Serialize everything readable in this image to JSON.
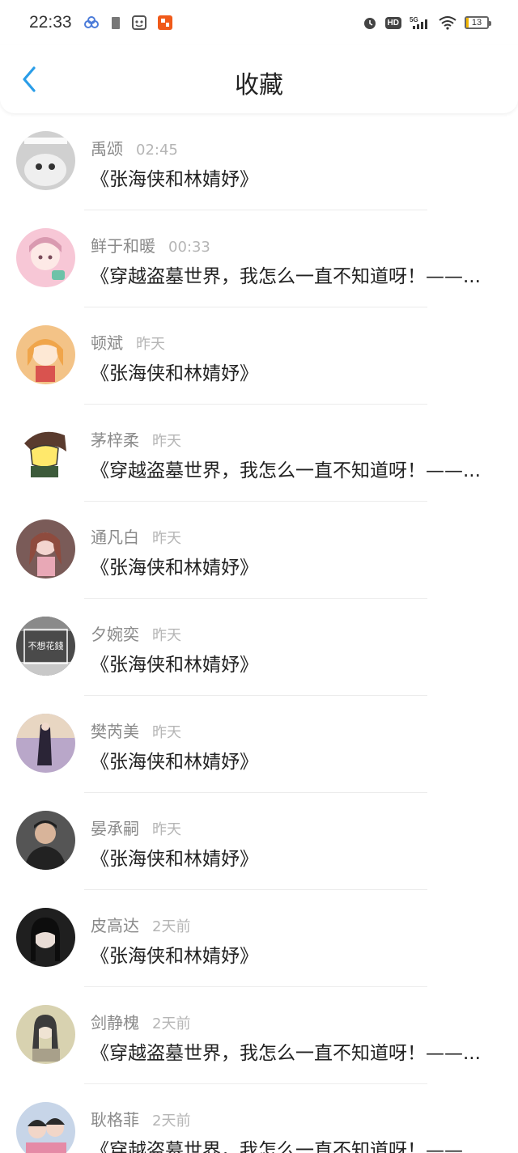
{
  "status_bar": {
    "time": "22:33",
    "battery": "13"
  },
  "header": {
    "title": "收藏"
  },
  "items": [
    {
      "name": "禹颂",
      "time": "02:45",
      "message": "《张海侠和林婧妤》",
      "avatar_color": "#d0d0d0"
    },
    {
      "name": "鲜于和暖",
      "time": "00:33",
      "message": "《穿越盗墓世界，我怎么一直不知道呀！——...",
      "avatar_color": "#f7c7d6"
    },
    {
      "name": "顿斌",
      "time": "昨天",
      "message": "《张海侠和林婧妤》",
      "avatar_color": "#f3c387"
    },
    {
      "name": "茅梓柔",
      "time": "昨天",
      "message": "《穿越盗墓世界，我怎么一直不知道呀！——...",
      "avatar_color": "#ffffff"
    },
    {
      "name": "通凡白",
      "time": "昨天",
      "message": "《张海侠和林婧妤》",
      "avatar_color": "#7a5b58"
    },
    {
      "name": "夕婉奕",
      "time": "昨天",
      "message": "《张海侠和林婧妤》",
      "avatar_color": "#4a4a4a",
      "avatar_text": "不想花錢"
    },
    {
      "name": "樊芮美",
      "time": "昨天",
      "message": "《张海侠和林婧妤》",
      "avatar_color": "#b9a7c9"
    },
    {
      "name": "晏承嗣",
      "time": "昨天",
      "message": "《张海侠和林婧妤》",
      "avatar_color": "#555555"
    },
    {
      "name": "皮高达",
      "time": "2天前",
      "message": "《张海侠和林婧妤》",
      "avatar_color": "#1f1f1f"
    },
    {
      "name": "剑静槐",
      "time": "2天前",
      "message": "《穿越盗墓世界，我怎么一直不知道呀！——...",
      "avatar_color": "#d8d2b0"
    },
    {
      "name": "耿格菲",
      "time": "2天前",
      "message": "《穿越盗墓世界，我怎么一直不知道呀！——...",
      "avatar_color": "#c7d5e8"
    }
  ]
}
